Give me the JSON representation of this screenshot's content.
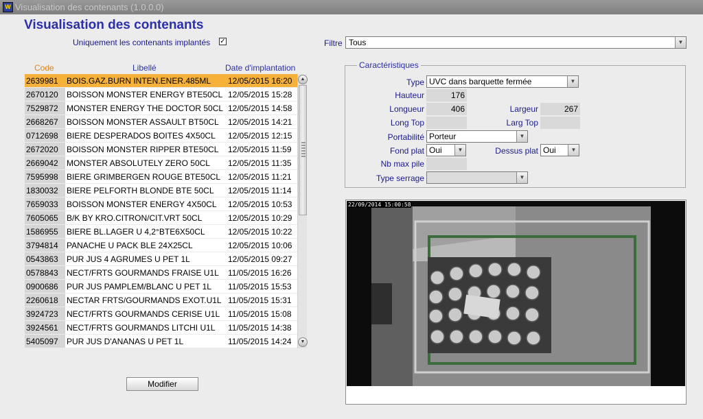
{
  "window": {
    "title": "Visualisation des contenants (1.0.0.0)"
  },
  "page": {
    "title": "Visualisation des contenants",
    "implanted_only_label": "Uniquement les contenants implantés",
    "implanted_only_checked": "✓"
  },
  "filter": {
    "label": "Filtre",
    "value": "Tous"
  },
  "list": {
    "headers": {
      "code": "Code",
      "label": "Libellé",
      "date": "Date d'implantation"
    },
    "rows": [
      {
        "code": "2639981",
        "label": "BOIS.GAZ.BURN INTEN.ENER.485ML",
        "date": "12/05/2015 16:20",
        "selected": true
      },
      {
        "code": "2670120",
        "label": "BOISSON MONSTER ENERGY BTE50CL",
        "date": "12/05/2015 15:28"
      },
      {
        "code": "7529872",
        "label": "MONSTER ENERGY THE DOCTOR 50CL",
        "date": "12/05/2015 14:58"
      },
      {
        "code": "2668267",
        "label": "BOISSON MONSTER ASSAULT BT50CL",
        "date": "12/05/2015 14:21"
      },
      {
        "code": "0712698",
        "label": "BIERE DESPERADOS BOITES 4X50CL",
        "date": "12/05/2015 12:15"
      },
      {
        "code": "2672020",
        "label": "BOISSON MONSTER RIPPER BTE50CL",
        "date": "12/05/2015 11:59"
      },
      {
        "code": "2669042",
        "label": "MONSTER ABSOLUTELY ZERO 50CL",
        "date": "12/05/2015 11:35"
      },
      {
        "code": "7595998",
        "label": "BIERE GRIMBERGEN ROUGE BTE50CL",
        "date": "12/05/2015 11:21"
      },
      {
        "code": "1830032",
        "label": "BIERE PELFORTH BLONDE BTE 50CL",
        "date": "12/05/2015 11:14"
      },
      {
        "code": "7659033",
        "label": "BOISSON MONSTER ENERGY 4X50CL",
        "date": "12/05/2015 10:53"
      },
      {
        "code": "7605065",
        "label": "B/K BY KRO.CITRON/CIT.VRT 50CL",
        "date": "12/05/2015 10:29"
      },
      {
        "code": "1586955",
        "label": "BIERE BL.LAGER U 4,2°BTE6X50CL",
        "date": "12/05/2015 10:22"
      },
      {
        "code": "3794814",
        "label": "PANACHE U PACK BLE 24X25CL",
        "date": "12/05/2015 10:06"
      },
      {
        "code": "0543863",
        "label": "PUR JUS 4 AGRUMES U PET 1L",
        "date": "12/05/2015 09:27"
      },
      {
        "code": "0578843",
        "label": "NECT/FRTS GOURMANDS FRAISE U1L",
        "date": "11/05/2015 16:26"
      },
      {
        "code": "0900686",
        "label": "PUR JUS PAMPLEM/BLANC U PET 1L",
        "date": "11/05/2015 15:53"
      },
      {
        "code": "2260618",
        "label": "NECTAR FRTS/GOURMANDS EXOT.U1L",
        "date": "11/05/2015 15:31"
      },
      {
        "code": "3924723",
        "label": "NECT/FRTS GOURMANDS CERISE U1L",
        "date": "11/05/2015 15:08"
      },
      {
        "code": "3924561",
        "label": "NECT/FRTS GOURMANDS LITCHI U1L",
        "date": "11/05/2015 14:38"
      },
      {
        "code": "5405097",
        "label": "PUR JUS D'ANANAS U PET 1L",
        "date": "11/05/2015 14:24"
      }
    ]
  },
  "buttons": {
    "modify": "Modifier"
  },
  "characteristics": {
    "legend": "Caractéristiques",
    "type_label": "Type",
    "type_value": "UVC dans barquette fermée",
    "height_label": "Hauteur",
    "height_value": "176",
    "length_label": "Longueur",
    "length_value": "406",
    "width_label": "Largeur",
    "width_value": "267",
    "long_top_label": "Long Top",
    "long_top_value": "",
    "larg_top_label": "Larg Top",
    "larg_top_value": "",
    "portability_label": "Portabilité",
    "portability_value": "Porteur",
    "fond_plat_label": "Fond plat",
    "fond_plat_value": "Oui",
    "dessus_plat_label": "Dessus plat",
    "dessus_plat_value": "Oui",
    "nb_max_pile_label": "Nb max pile",
    "nb_max_pile_value": "",
    "type_serrage_label": "Type serrage",
    "type_serrage_value": ""
  },
  "camera": {
    "timestamp": "22/09/2014 15:00:58"
  },
  "colors": {
    "title": "#2b2fa8",
    "selected_row": "#f6b13a",
    "code_header": "#e0841a"
  }
}
